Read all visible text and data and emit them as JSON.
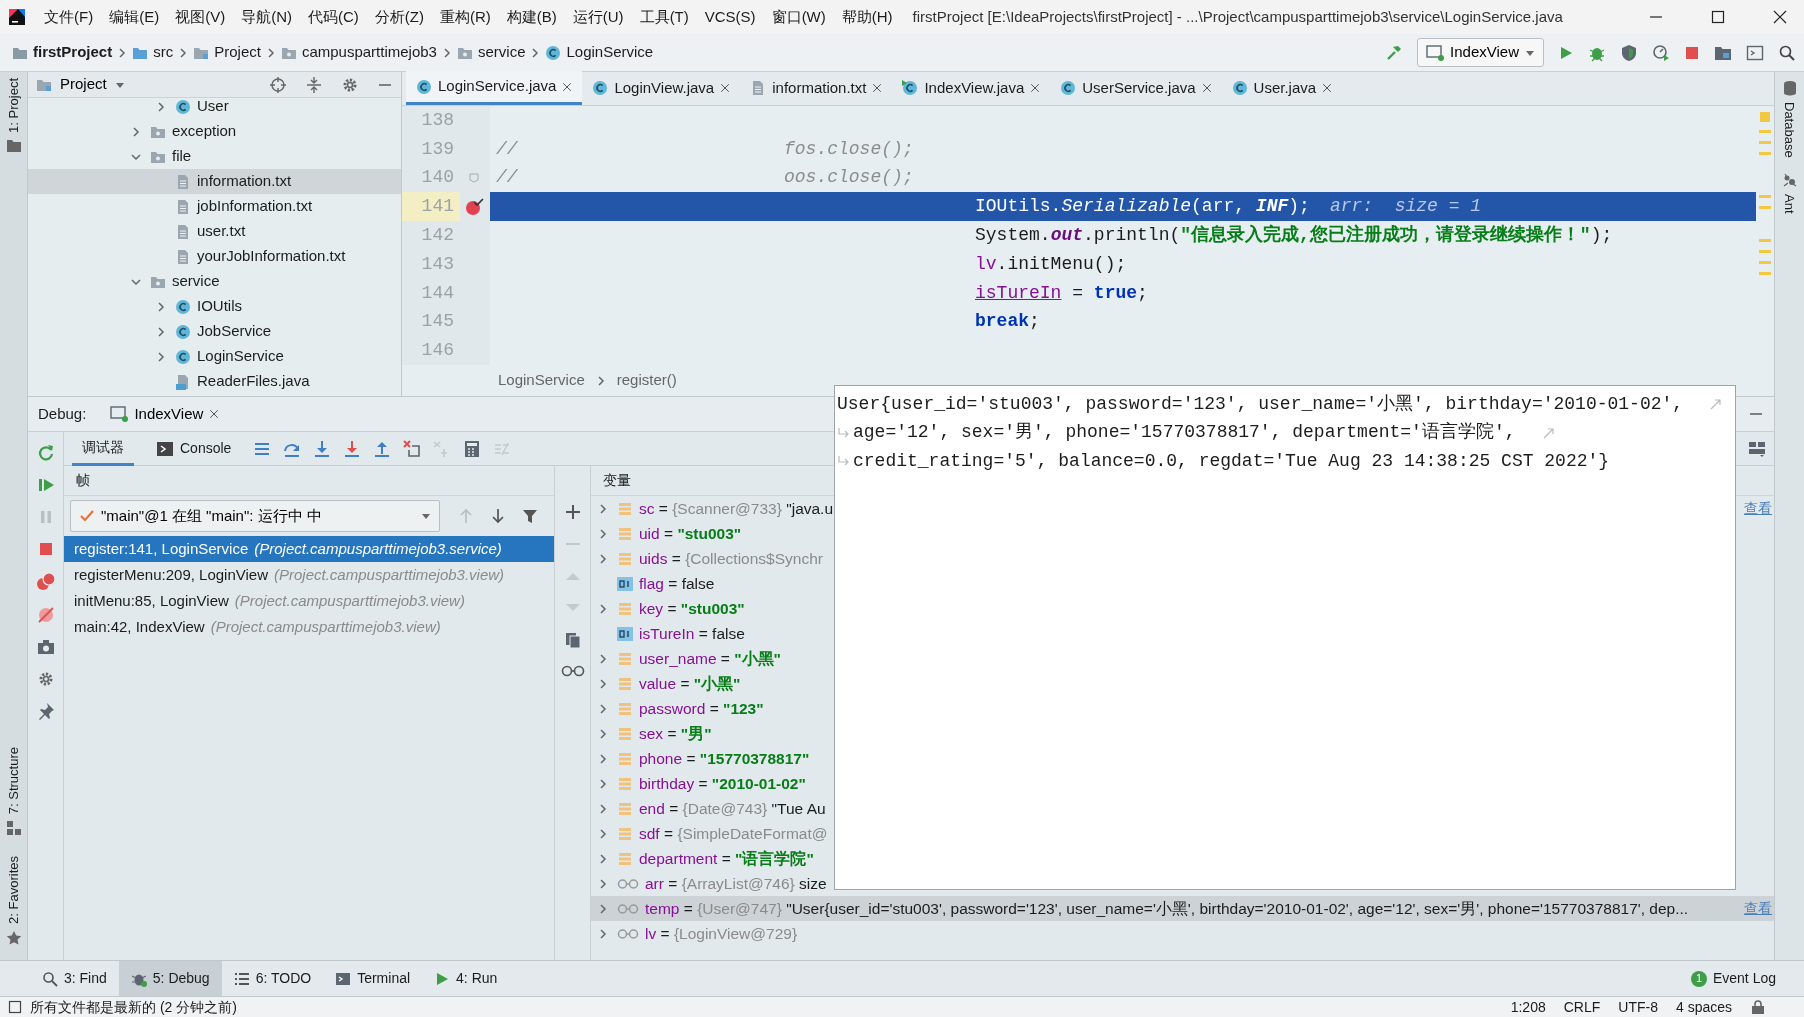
{
  "menu_bar": {
    "items": [
      "文件(F)",
      "编辑(E)",
      "视图(V)",
      "导航(N)",
      "代码(C)",
      "分析(Z)",
      "重构(R)",
      "构建(B)",
      "运行(U)",
      "工具(T)",
      "VCS(S)",
      "窗口(W)",
      "帮助(H)"
    ],
    "title": "firstProject [E:\\IdeaProjects\\firstProject] - ...\\Project\\campusparttimejob3\\service\\LoginService.java"
  },
  "navigation_bar": {
    "breadcrumbs": [
      {
        "label": "firstProject",
        "kind": "project"
      },
      {
        "label": "src",
        "kind": "source-folder"
      },
      {
        "label": "Project",
        "kind": "module"
      },
      {
        "label": "campusparttimejob3",
        "kind": "package"
      },
      {
        "label": "service",
        "kind": "package"
      },
      {
        "label": "LoginService",
        "kind": "class"
      }
    ],
    "run_configuration": "IndexView"
  },
  "left_stripe": {
    "top": [
      "1: Project"
    ],
    "bottom": [
      "7: Structure",
      "2: Favorites"
    ]
  },
  "right_stripe": [
    "Database",
    "Ant"
  ],
  "project_panel": {
    "title": "Project",
    "tree": [
      {
        "children": [
          {
            "label": "User",
            "kind": "class",
            "expanded": false,
            "selected": false
          }
        ]
      },
      {
        "label": "exception",
        "kind": "folder",
        "expanded": false,
        "selected": false
      },
      {
        "label": "file",
        "kind": "folder",
        "expanded": true,
        "selected": false,
        "children": [
          {
            "label": "information.txt",
            "kind": "text-file",
            "selected": true
          },
          {
            "label": "jobInformation.txt",
            "kind": "text-file",
            "selected": false
          },
          {
            "label": "user.txt",
            "kind": "text-file",
            "selected": false
          },
          {
            "label": "yourJobInformation.txt",
            "kind": "text-file",
            "selected": false
          }
        ]
      },
      {
        "label": "service",
        "kind": "folder",
        "expanded": true,
        "selected": false,
        "children": [
          {
            "label": "IOUtils",
            "kind": "class",
            "expanded": false,
            "selected": false
          },
          {
            "label": "JobService",
            "kind": "class",
            "expanded": false,
            "selected": false
          },
          {
            "label": "LoginService",
            "kind": "class",
            "expanded": false,
            "selected": false
          },
          {
            "label": "ReaderFiles.java",
            "kind": "java-file",
            "selected": false
          }
        ]
      }
    ]
  },
  "editor": {
    "tabs": [
      {
        "label": "LoginService.java",
        "kind": "class",
        "selected": true
      },
      {
        "label": "LoginView.java",
        "kind": "class",
        "selected": false
      },
      {
        "label": "information.txt",
        "kind": "text-file",
        "selected": false
      },
      {
        "label": "IndexView.java",
        "kind": "runnable-class",
        "selected": false
      },
      {
        "label": "UserService.java",
        "kind": "class",
        "selected": false
      },
      {
        "label": "User.java",
        "kind": "class",
        "selected": false
      }
    ],
    "lines": [
      {
        "number": "138",
        "kind": "code",
        "current": false,
        "breakpoint": false
      },
      {
        "number": "139",
        "kind": "commented",
        "current": false,
        "breakpoint": false,
        "prefix": "//",
        "tokens": [
          {
            "text": "fos.close();",
            "kind": "comment"
          }
        ]
      },
      {
        "number": "140",
        "kind": "commented",
        "current": false,
        "breakpoint": false,
        "prefix": "//",
        "tokens": [
          {
            "text": "oos.close();",
            "kind": "comment"
          }
        ]
      },
      {
        "number": "141",
        "kind": "code",
        "current": true,
        "breakpoint": true,
        "tokens": [
          {
            "text": "IOUtils.",
            "kind": "plain"
          },
          {
            "text": "Serializable",
            "kind": "static"
          },
          {
            "text": "(arr, ",
            "kind": "plain"
          },
          {
            "text": "INF",
            "kind": "constant"
          },
          {
            "text": ");",
            "kind": "plain"
          },
          {
            "text": "arr:  size = 1",
            "kind": "hint"
          }
        ]
      },
      {
        "number": "142",
        "kind": "code",
        "current": false,
        "breakpoint": false,
        "tokens": [
          {
            "text": "System.",
            "kind": "plain"
          },
          {
            "text": "out",
            "kind": "field"
          },
          {
            "text": ".println(",
            "kind": "plain"
          },
          {
            "text": "\"信息录入完成,您已注册成功，请登录继续操作！\"",
            "kind": "string"
          },
          {
            "text": ");",
            "kind": "plain"
          }
        ]
      },
      {
        "number": "143",
        "kind": "code",
        "current": false,
        "breakpoint": false,
        "tokens": [
          {
            "text": "lv",
            "kind": "local-field"
          },
          {
            "text": ".initMenu();",
            "kind": "plain"
          }
        ]
      },
      {
        "number": "144",
        "kind": "code",
        "current": false,
        "breakpoint": false,
        "tokens": [
          {
            "text": "isTureIn",
            "kind": "underlined-field"
          },
          {
            "text": " = ",
            "kind": "plain"
          },
          {
            "text": "true",
            "kind": "keyword"
          },
          {
            "text": ";",
            "kind": "plain"
          }
        ]
      },
      {
        "number": "145",
        "kind": "code",
        "current": false,
        "breakpoint": false,
        "tokens": [
          {
            "text": "break",
            "kind": "keyword"
          },
          {
            "text": ";",
            "kind": "plain"
          }
        ]
      },
      {
        "number": "146",
        "kind": "code",
        "current": false,
        "breakpoint": false
      }
    ],
    "breadcrumbs": [
      "LoginService",
      "register()"
    ]
  },
  "debug": {
    "title": "Debug:",
    "session_tab": "IndexView",
    "tabs": [
      {
        "label": "调试器",
        "selected": true
      },
      {
        "label": "Console",
        "selected": false
      }
    ],
    "frames": {
      "header": "帧",
      "thread": "\"main\"@1 在组 \"main\": 运行中 中",
      "items": [
        {
          "method": "register:141, LoginService",
          "package": "(Project.campusparttimejob3.service)",
          "selected": true
        },
        {
          "method": "registerMenu:209, LoginView",
          "package": "(Project.campusparttimejob3.view)",
          "selected": false
        },
        {
          "method": "initMenu:85, LoginView",
          "package": "(Project.campusparttimejob3.view)",
          "selected": false
        },
        {
          "method": "main:42, IndexView",
          "package": "(Project.campusparttimejob3.view)",
          "selected": false
        }
      ]
    },
    "variables": {
      "header": "变量",
      "items": [
        {
          "kind": "field",
          "name": "sc",
          "sign": "=",
          "type": "{Scanner@733}",
          "value": "\"java.u",
          "expandable": true,
          "selected": false,
          "view_link": "查看"
        },
        {
          "kind": "field",
          "name": "uid",
          "sign": "=",
          "string_value": "\"stu003\"",
          "expandable": true,
          "selected": false
        },
        {
          "kind": "field",
          "name": "uids",
          "sign": "=",
          "type": "{Collections$Synchr",
          "expandable": true,
          "selected": false
        },
        {
          "kind": "primitive",
          "name": "flag",
          "sign": "=",
          "value": "false",
          "expandable": false,
          "selected": false
        },
        {
          "kind": "field",
          "name": "key",
          "sign": "=",
          "string_value": "\"stu003\"",
          "expandable": true,
          "selected": false
        },
        {
          "kind": "primitive",
          "name": "isTureIn",
          "sign": "=",
          "value": "false",
          "expandable": false,
          "selected": false
        },
        {
          "kind": "field",
          "name": "user_name",
          "sign": "=",
          "string_value": "\"小黑\"",
          "expandable": true,
          "selected": false
        },
        {
          "kind": "field",
          "name": "value",
          "sign": "=",
          "string_value": "\"小黑\"",
          "expandable": true,
          "selected": false
        },
        {
          "kind": "field",
          "name": "password",
          "sign": "=",
          "string_value": "\"123\"",
          "expandable": true,
          "selected": false
        },
        {
          "kind": "field",
          "name": "sex",
          "sign": "=",
          "string_value": "\"男\"",
          "expandable": true,
          "selected": false
        },
        {
          "kind": "field",
          "name": "phone",
          "sign": "=",
          "string_value": "\"15770378817\"",
          "expandable": true,
          "selected": false
        },
        {
          "kind": "field",
          "name": "birthday",
          "sign": "=",
          "string_value": "\"2010-01-02\"",
          "expandable": true,
          "selected": false
        },
        {
          "kind": "field",
          "name": "end",
          "sign": "=",
          "type": "{Date@743}",
          "value": "\"Tue Au",
          "expandable": true,
          "selected": false
        },
        {
          "kind": "field",
          "name": "sdf",
          "sign": "=",
          "type": "{SimpleDateFormat@",
          "expandable": true,
          "selected": false
        },
        {
          "kind": "field",
          "name": "department",
          "sign": "=",
          "string_value": "\"语言学院\"",
          "expandable": true,
          "selected": false
        },
        {
          "kind": "watch",
          "name": "arr",
          "sign": "=",
          "type": "{ArrayList@746}",
          "value": "size",
          "expandable": true,
          "selected": false
        },
        {
          "kind": "watch",
          "name": "temp",
          "sign": "=",
          "type": "{User@747}",
          "value": "\"User{user_id='stu003', password='123', user_name='小黑', birthday='2010-01-02', age='12', sex='男', phone='15770378817', dep...",
          "expandable": true,
          "selected": true,
          "view_link": "查看"
        },
        {
          "kind": "watch",
          "name": "lv",
          "sign": "=",
          "type": "{LoginView@729}",
          "expandable": true,
          "selected": false
        }
      ]
    },
    "popup": {
      "lines": [
        "User{user_id='stu003', password='123', user_name='小黑', birthday='2010-01-02',",
        "age='12', sex='男', phone='15770378817', department='语言学院',",
        "credit_rating='5', balance=0.0, regdat='Tue Aug 23 14:38:25 CST 2022'}"
      ]
    }
  },
  "tool_tabs": [
    {
      "label": "3: Find",
      "kind": "find",
      "selected": false
    },
    {
      "label": "5: Debug",
      "kind": "debug",
      "selected": true
    },
    {
      "label": "6: TODO",
      "kind": "todo",
      "selected": false
    },
    {
      "label": "Terminal",
      "kind": "terminal",
      "selected": false
    },
    {
      "label": "4: Run",
      "kind": "run",
      "selected": false
    }
  ],
  "event_log": {
    "label": "Event Log",
    "count": "1"
  },
  "status_bar": {
    "message": "所有文件都是最新的 (2 分钟之前)",
    "position": "1:208",
    "line_separator": "CRLF",
    "encoding": "UTF-8",
    "indent": "4 spaces"
  }
}
